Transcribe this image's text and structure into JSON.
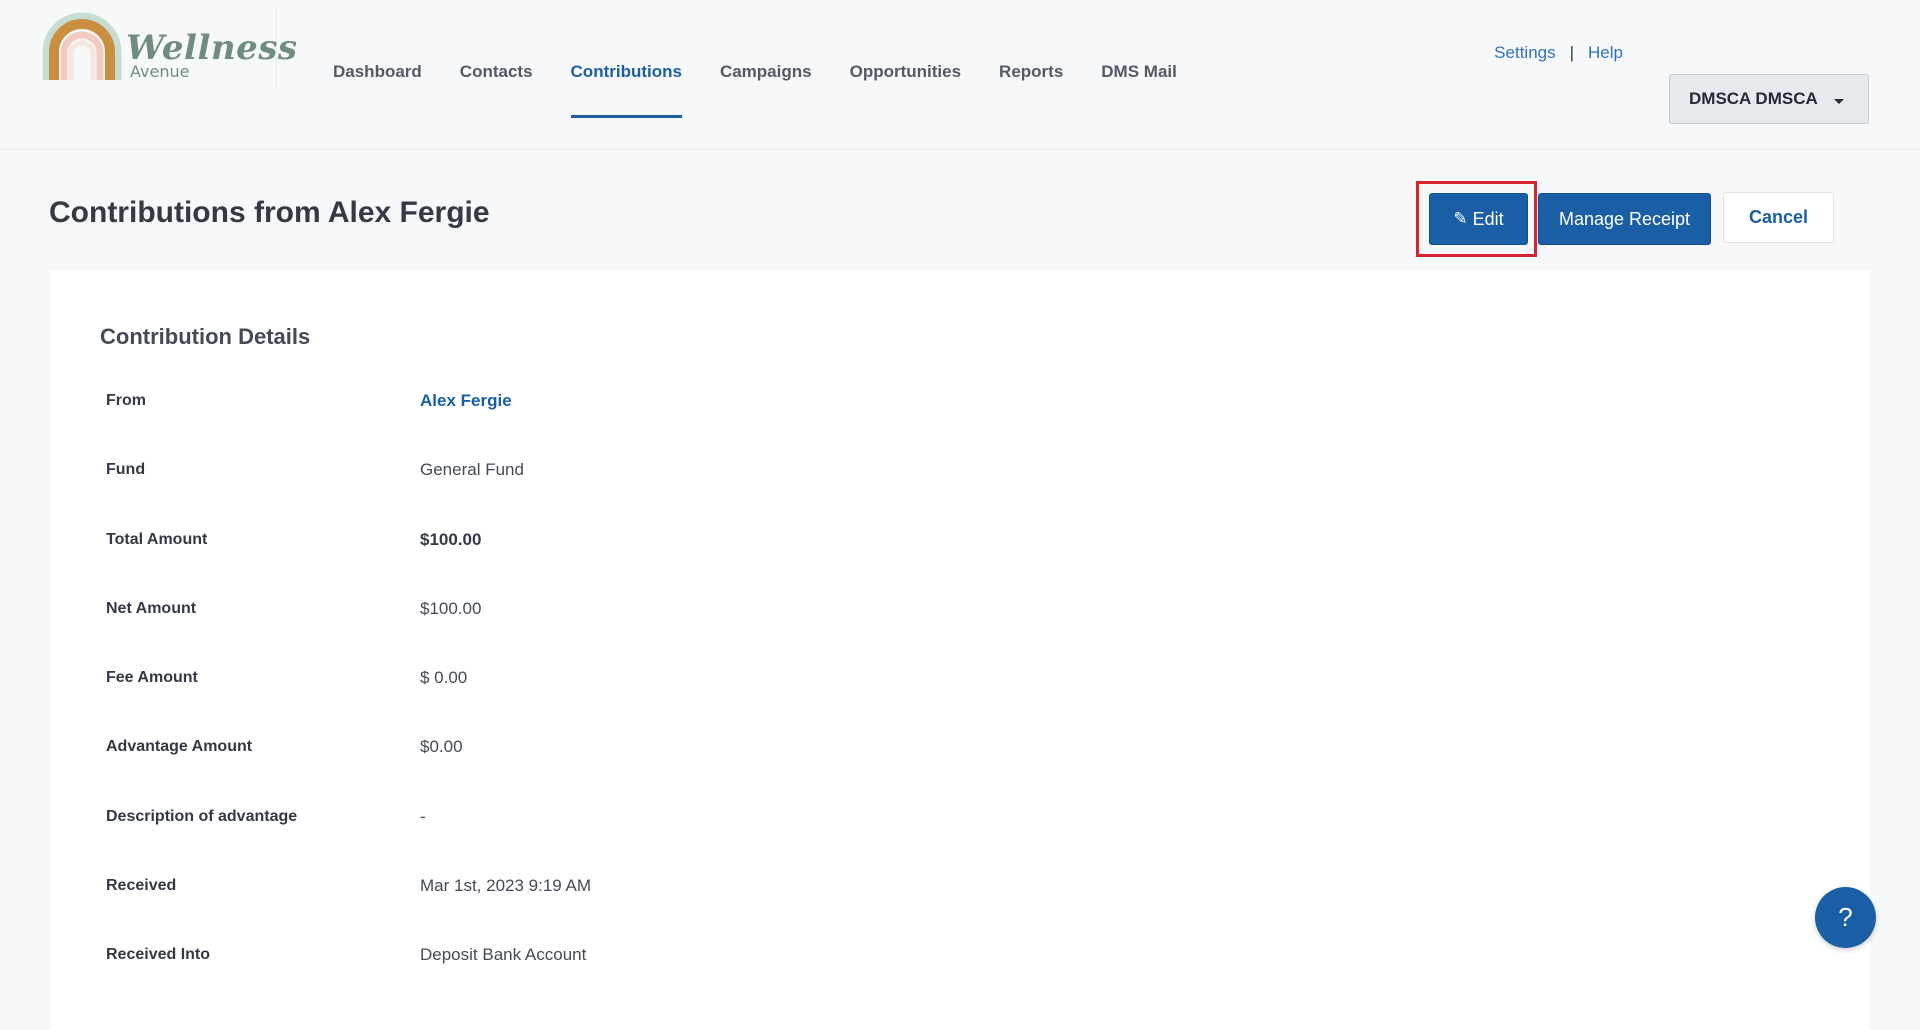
{
  "brand": {
    "name": "Wellness",
    "subtitle": "Avenue"
  },
  "nav": {
    "items": [
      {
        "label": "Dashboard",
        "active": false
      },
      {
        "label": "Contacts",
        "active": false
      },
      {
        "label": "Contributions",
        "active": true
      },
      {
        "label": "Campaigns",
        "active": false
      },
      {
        "label": "Opportunities",
        "active": false
      },
      {
        "label": "Reports",
        "active": false
      },
      {
        "label": "DMS Mail",
        "active": false
      }
    ]
  },
  "util": {
    "settings": "Settings",
    "separator": "|",
    "help": "Help"
  },
  "user": {
    "name": "DMSCA DMSCA"
  },
  "page": {
    "title": "Contributions from Alex Fergie"
  },
  "actions": {
    "edit_icon": "pencil-icon",
    "edit": "Edit",
    "manage_receipt": "Manage Receipt",
    "cancel": "Cancel"
  },
  "details": {
    "title": "Contribution Details",
    "rows": [
      {
        "label": "From",
        "value": "Alex Fergie",
        "style": "link"
      },
      {
        "label": "Fund",
        "value": "General Fund",
        "style": "plain"
      },
      {
        "label": "Total Amount",
        "value": "$100.00",
        "style": "strong"
      },
      {
        "label": "Net Amount",
        "value": "$100.00",
        "style": "plain"
      },
      {
        "label": "Fee Amount",
        "value": "$ 0.00",
        "style": "plain"
      },
      {
        "label": "Advantage Amount",
        "value": "$0.00",
        "style": "plain"
      },
      {
        "label": "Description of advantage",
        "value": "-",
        "style": "plain"
      },
      {
        "label": "Received",
        "value": "Mar 1st, 2023 9:19 AM",
        "style": "plain"
      },
      {
        "label": "Received Into",
        "value": "Deposit Bank Account",
        "style": "plain"
      }
    ]
  },
  "help_bubble": {
    "label": "?"
  },
  "colors": {
    "primary": "#1a5ea6",
    "highlight": "#d9232e",
    "logo_green": "#6f8d7d"
  }
}
